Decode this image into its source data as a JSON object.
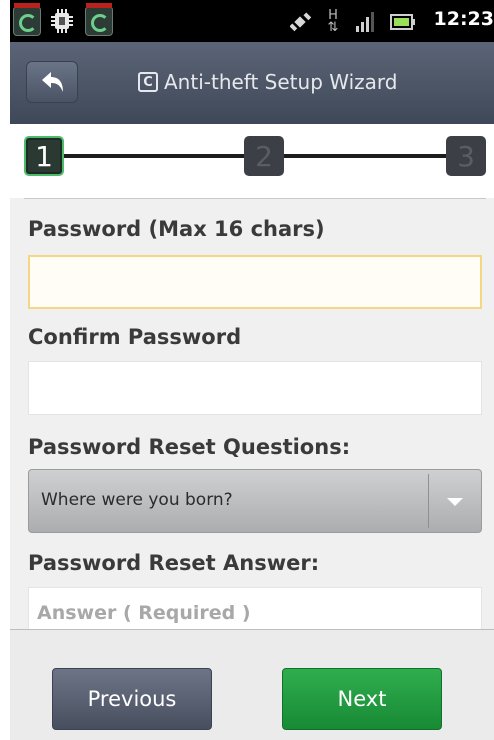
{
  "status_bar": {
    "time": "12:23",
    "icons": [
      "comodo-app-icon",
      "sd-card-icon",
      "comodo-app-icon",
      "satellite-icon",
      "data-arrows-icon",
      "signal-icon",
      "battery-icon"
    ],
    "network_letter": "H"
  },
  "header": {
    "title": "Anti-theft Setup Wizard",
    "logo_letter": "C",
    "back_icon": "back-arrow-icon"
  },
  "steps": {
    "items": [
      "1",
      "2",
      "3"
    ],
    "current": 1
  },
  "form": {
    "password_label": "Password (Max 16 chars)",
    "password_value": "",
    "confirm_label": "Confirm Password",
    "confirm_value": "",
    "questions_label": "Password Reset Questions:",
    "question_selected": "Where were you born?",
    "answer_label": "Password Reset Answer:",
    "answer_placeholder": "Answer ( Required )"
  },
  "footer": {
    "previous_label": "Previous",
    "next_label": "Next"
  },
  "colors": {
    "accent_green": "#1f9a40",
    "title_bar": "#4a5364",
    "focus_border": "#f4d784"
  }
}
